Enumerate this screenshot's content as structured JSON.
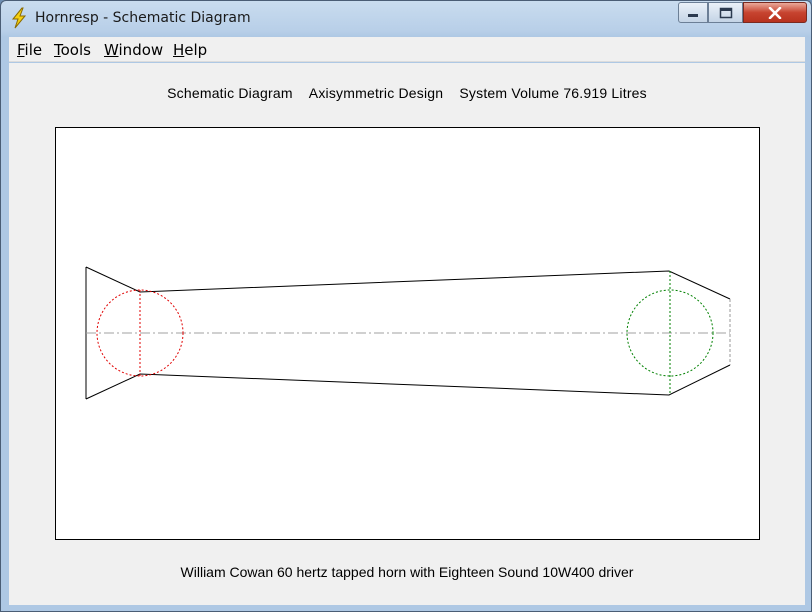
{
  "window": {
    "title": "Hornresp - Schematic Diagram",
    "icon": "lightning-bolt-icon"
  },
  "controls": {
    "minimize_icon": "minimize-icon",
    "maximize_icon": "maximize-icon",
    "close_icon": "close-icon"
  },
  "menu": {
    "items": [
      {
        "key": "F",
        "rest": "ile"
      },
      {
        "key": "T",
        "rest": "ools"
      },
      {
        "key": "W",
        "rest": "indow"
      },
      {
        "key": "H",
        "rest": "elp"
      }
    ]
  },
  "heading": {
    "part1": "Schematic Diagram",
    "part2": "Axisymmetric Design",
    "part3": "System Volume 76.919 Litres"
  },
  "footer": {
    "caption": "William Cowan 60 hertz tapped horn with Eighteen Sound 10W400 driver"
  },
  "colors": {
    "driver1": "#e00000",
    "driver2": "#008000",
    "outline": "#000000",
    "axis": "#a0a0a0"
  }
}
